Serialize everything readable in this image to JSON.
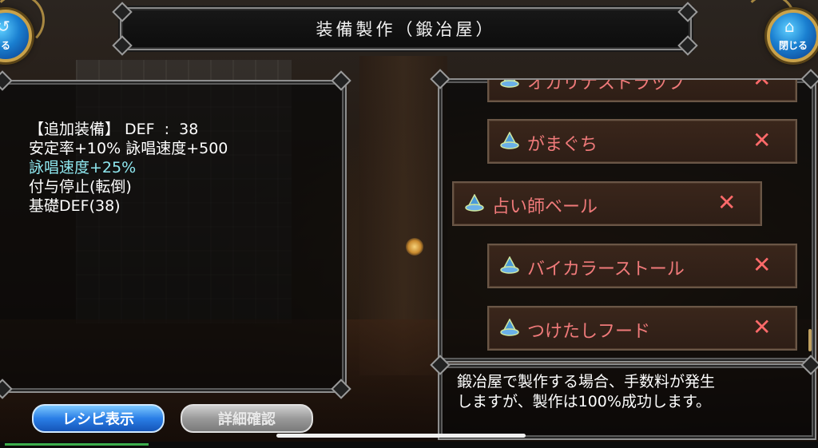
{
  "header": {
    "title": "装備製作（鍛冶屋）",
    "left_button_label": "る",
    "right_button_label": "閉じる"
  },
  "stats": {
    "lines": [
      "【追加装備】 DEF  :  38",
      "安定率+10% 詠唱速度+500",
      "詠唱速度+25%",
      "付与停止(転倒)",
      "基礎DEF(38)"
    ]
  },
  "item_list": {
    "items": [
      {
        "name": "オカリナストラップ",
        "remove": "✕"
      },
      {
        "name": "がまぐち",
        "remove": "✕"
      },
      {
        "name": "占い師ベール",
        "remove": "✕"
      },
      {
        "name": "バイカラーストール",
        "remove": "✕"
      },
      {
        "name": "つけたしフード",
        "remove": "✕"
      }
    ]
  },
  "message": {
    "text_line1": "鍛冶屋で製作する場合、手数料が発生",
    "text_line2": "しますが、製作は100%成功します。"
  },
  "buttons": {
    "recipe": "レシピ表示",
    "detail": "詳細確認"
  },
  "colors": {
    "item_text": "#f07a7a",
    "stat_highlight": "#8fe8f0",
    "recipe_button": "#2a7ee6"
  }
}
